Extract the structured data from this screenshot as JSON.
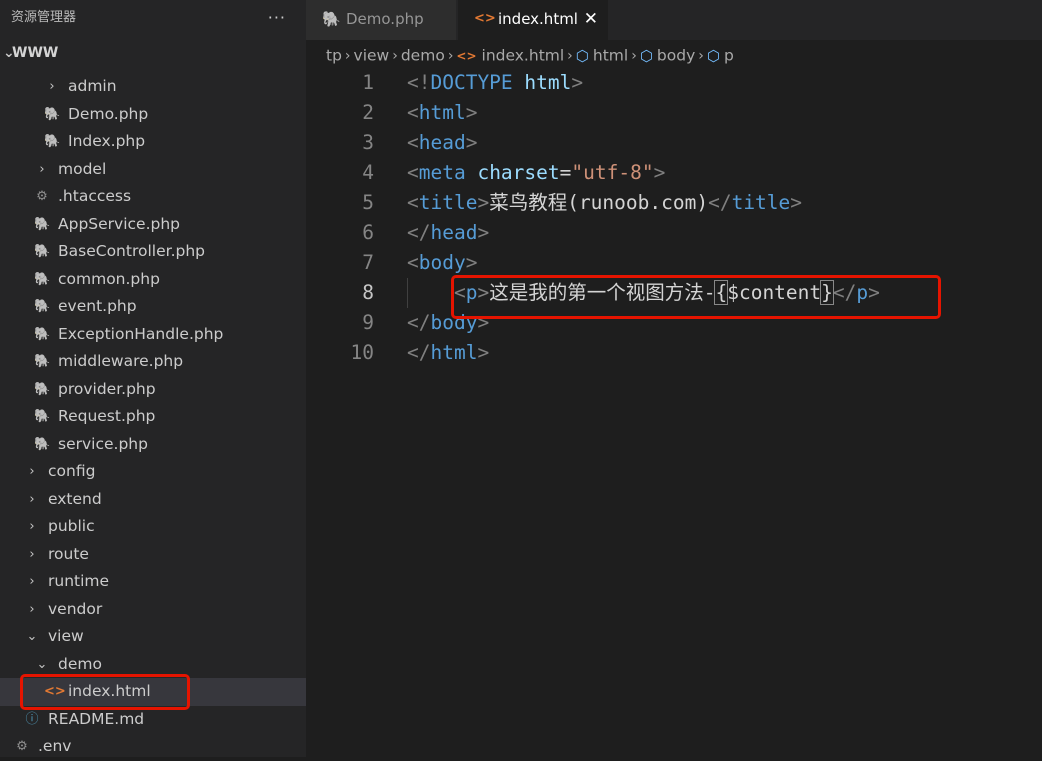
{
  "explorer": {
    "title": "资源管理器",
    "more": "···",
    "root": "WWW",
    "items": [
      {
        "label": "admin",
        "kind": "folder",
        "expanded": false,
        "depth": 3
      },
      {
        "label": "Demo.php",
        "kind": "php",
        "depth": 3
      },
      {
        "label": "Index.php",
        "kind": "php",
        "depth": 3
      },
      {
        "label": "model",
        "kind": "folder",
        "expanded": false,
        "depth": 2
      },
      {
        "label": ".htaccess",
        "kind": "config",
        "depth": 2
      },
      {
        "label": "AppService.php",
        "kind": "php",
        "depth": 2
      },
      {
        "label": "BaseController.php",
        "kind": "php",
        "depth": 2
      },
      {
        "label": "common.php",
        "kind": "php",
        "depth": 2
      },
      {
        "label": "event.php",
        "kind": "php",
        "depth": 2
      },
      {
        "label": "ExceptionHandle.php",
        "kind": "php",
        "depth": 2
      },
      {
        "label": "middleware.php",
        "kind": "php",
        "depth": 2
      },
      {
        "label": "provider.php",
        "kind": "php",
        "depth": 2
      },
      {
        "label": "Request.php",
        "kind": "php",
        "depth": 2
      },
      {
        "label": "service.php",
        "kind": "php",
        "depth": 2
      },
      {
        "label": "config",
        "kind": "folder",
        "expanded": false,
        "depth": 1
      },
      {
        "label": "extend",
        "kind": "folder",
        "expanded": false,
        "depth": 1
      },
      {
        "label": "public",
        "kind": "folder",
        "expanded": false,
        "depth": 1
      },
      {
        "label": "route",
        "kind": "folder",
        "expanded": false,
        "depth": 1
      },
      {
        "label": "runtime",
        "kind": "folder",
        "expanded": false,
        "depth": 1
      },
      {
        "label": "vendor",
        "kind": "folder",
        "expanded": false,
        "depth": 1
      },
      {
        "label": "view",
        "kind": "folder",
        "expanded": true,
        "depth": 1
      },
      {
        "label": "demo",
        "kind": "folder",
        "expanded": true,
        "depth": 2
      },
      {
        "label": "index.html",
        "kind": "html",
        "depth": 3,
        "selected": true
      },
      {
        "label": "README.md",
        "kind": "info",
        "depth": 1
      },
      {
        "label": ".env",
        "kind": "config",
        "depth": 0
      }
    ]
  },
  "tabs": [
    {
      "label": "Demo.php",
      "active": false,
      "icon": "php-elephant-icon"
    },
    {
      "label": "index.html",
      "active": true,
      "icon": "html-icon",
      "close": "✕"
    }
  ],
  "breadcrumb": {
    "parts": [
      "tp",
      "view",
      "demo"
    ],
    "file": "index.html",
    "symbols": [
      "html",
      "body",
      "p"
    ]
  },
  "editor": {
    "line_numbers": [
      "1",
      "2",
      "3",
      "4",
      "5",
      "6",
      "7",
      "8",
      "9",
      "10"
    ],
    "current_line": 8,
    "lines": [
      [
        [
          "bracket",
          "<!"
        ],
        [
          "tag",
          "DOCTYPE "
        ],
        [
          "attr",
          "html"
        ],
        [
          "bracket",
          ">"
        ]
      ],
      [
        [
          "bracket",
          "<"
        ],
        [
          "tag",
          "html"
        ],
        [
          "bracket",
          ">"
        ]
      ],
      [
        [
          "bracket",
          "<"
        ],
        [
          "tag",
          "head"
        ],
        [
          "bracket",
          ">"
        ]
      ],
      [
        [
          "bracket",
          "<"
        ],
        [
          "tag",
          "meta "
        ],
        [
          "attr",
          "charset"
        ],
        [
          "text",
          "="
        ],
        [
          "str",
          "\"utf-8\""
        ],
        [
          "bracket",
          ">"
        ]
      ],
      [
        [
          "bracket",
          "<"
        ],
        [
          "tag",
          "title"
        ],
        [
          "bracket",
          ">"
        ],
        [
          "text",
          "菜鸟教程(runoob.com)"
        ],
        [
          "bracket",
          "</"
        ],
        [
          "tag",
          "title"
        ],
        [
          "bracket",
          ">"
        ]
      ],
      [
        [
          "bracket",
          "</"
        ],
        [
          "tag",
          "head"
        ],
        [
          "bracket",
          ">"
        ]
      ],
      [
        [
          "bracket",
          "<"
        ],
        [
          "tag",
          "body"
        ],
        [
          "bracket",
          ">"
        ]
      ],
      [
        [
          "text",
          "    "
        ],
        [
          "bracket",
          "<"
        ],
        [
          "tag",
          "p"
        ],
        [
          "bracket",
          ">"
        ],
        [
          "text",
          "这是我的第一个视图方法-"
        ],
        [
          "match",
          "{"
        ],
        [
          "text",
          "$content"
        ],
        [
          "match",
          "}"
        ],
        [
          "bracket",
          "</"
        ],
        [
          "tag",
          "p"
        ],
        [
          "bracket",
          ">"
        ]
      ],
      [
        [
          "bracket",
          "</"
        ],
        [
          "tag",
          "body"
        ],
        [
          "bracket",
          ">"
        ]
      ],
      [
        [
          "bracket",
          "</"
        ],
        [
          "tag",
          "html"
        ],
        [
          "bracket",
          ">"
        ]
      ]
    ]
  },
  "colors": {
    "highlight_box": "#e51400",
    "php_icon": "#a074c4",
    "html_icon": "#e37933",
    "tag": "#569cd6",
    "attr": "#9cdcfe",
    "string": "#ce9178"
  }
}
